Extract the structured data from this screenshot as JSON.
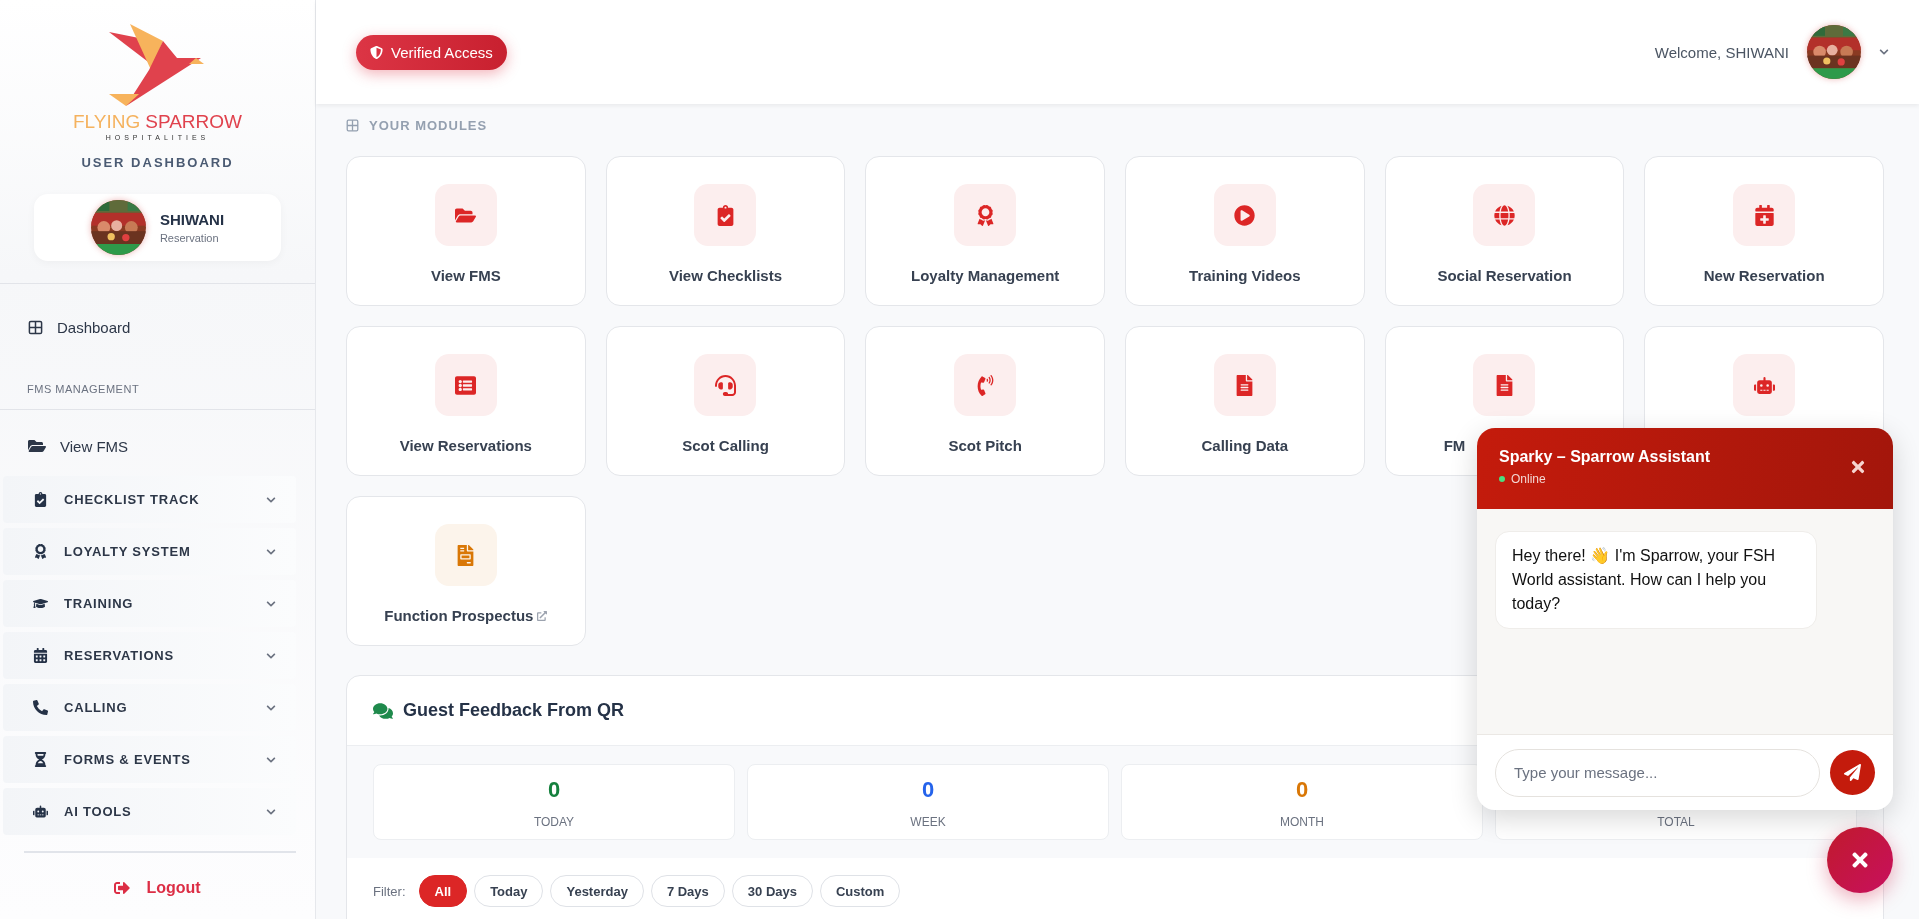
{
  "sidebar": {
    "brand": {
      "words": [
        "FLYING",
        "SPARROW"
      ],
      "tagline": "HOSPITALITIES"
    },
    "title": "USER DASHBOARD",
    "user": {
      "name": "SHIWANI",
      "role": "Reservation"
    },
    "dashboard": "Dashboard",
    "section": "FMS MANAGEMENT",
    "view_fms": "View FMS",
    "groups": [
      {
        "label": "CHECKLIST TRACK",
        "expanded": false
      },
      {
        "label": "LOYALTY SYSTEM",
        "expanded": false
      },
      {
        "label": "TRAINING",
        "expanded": false
      },
      {
        "label": "RESERVATIONS",
        "expanded": false
      },
      {
        "label": "CALLING",
        "expanded": false
      },
      {
        "label": "FORMS & EVENTS",
        "expanded": false
      },
      {
        "label": "AI TOOLS",
        "expanded": false
      }
    ],
    "logout": "Logout"
  },
  "header": {
    "badge": "Verified Access",
    "welcome": "Welcome, SHIWANI"
  },
  "modules": {
    "title": "YOUR MODULES",
    "items": [
      {
        "label": "View FMS",
        "color": "#dc2626",
        "external": false
      },
      {
        "label": "View Checklists",
        "color": "#dc2626",
        "external": false
      },
      {
        "label": "Loyalty Management",
        "color": "#dc2626",
        "external": false
      },
      {
        "label": "Training Videos",
        "color": "#dc2626",
        "external": false
      },
      {
        "label": "Social Reservation",
        "color": "#dc2626",
        "external": false
      },
      {
        "label": "New Reservation",
        "color": "#dc2626",
        "external": false
      },
      {
        "label": "View Reservations",
        "color": "#dc2626",
        "external": false
      },
      {
        "label": "Scot Calling",
        "color": "#dc2626",
        "external": false
      },
      {
        "label": "Scot Pitch",
        "color": "#dc2626",
        "external": false
      },
      {
        "label": "Calling Data",
        "color": "#dc2626",
        "external": false
      },
      {
        "label": "FM",
        "color": "#dc2626",
        "external": false,
        "cut": true
      },
      {
        "color": "#dc2626",
        "external": false
      },
      {
        "label": "Function Prospectus",
        "color": "#d97706",
        "external": true
      }
    ]
  },
  "feedback": {
    "title": "Guest Feedback From QR",
    "stats": [
      {
        "value": "0",
        "label": "TODAY",
        "color": "#15803d"
      },
      {
        "value": "0",
        "label": "WEEK",
        "color": "#2563eb"
      },
      {
        "value": "0",
        "label": "MONTH",
        "color": "#d97706"
      },
      {
        "label": "TOTAL"
      }
    ],
    "filter_label": "Filter:",
    "filters": [
      {
        "label": "All",
        "selected": true
      },
      {
        "label": "Today",
        "selected": false
      },
      {
        "label": "Yesterday",
        "selected": false
      },
      {
        "label": "7 Days",
        "selected": false
      },
      {
        "label": "30 Days",
        "selected": false
      },
      {
        "label": "Custom",
        "selected": false
      }
    ]
  },
  "chat": {
    "title": "Sparky – Sparrow Assistant",
    "status": "Online",
    "online": true,
    "messages": [
      {
        "text": "Hey there! 👋 I'm Sparrow, your FSH World assistant. How can I help you today?"
      }
    ],
    "placeholder": "Type your message..."
  }
}
